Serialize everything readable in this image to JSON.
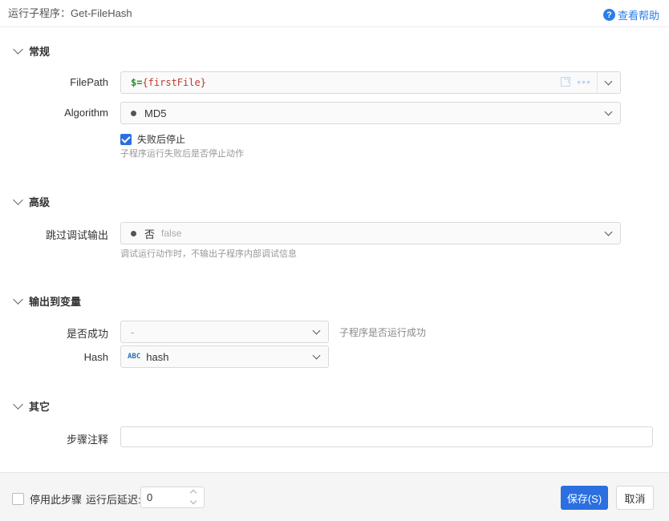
{
  "header": {
    "title": "运行子程序：Get-FileHash",
    "help_label": "查看帮助"
  },
  "sections": {
    "general": {
      "title": "常规",
      "filepath": {
        "label": "FilePath",
        "expr_dollar": "$=",
        "expr_var": "{firstFile}"
      },
      "algorithm": {
        "label": "Algorithm",
        "value": "MD5"
      },
      "stop_on_fail": {
        "label": "失败后停止",
        "checked": true,
        "hint": "子程序运行失败后是否停止动作"
      }
    },
    "advanced": {
      "title": "高级",
      "skip_debug": {
        "label": "跳过调试输出",
        "value": "否",
        "value_sub": "false",
        "hint": "调试运行动作时，不输出子程序内部调试信息"
      }
    },
    "output": {
      "title": "输出到变量",
      "success": {
        "label": "是否成功",
        "value": "-",
        "hint": "子程序是否运行成功"
      },
      "hash": {
        "label": "Hash",
        "type_badge": "ABC",
        "value": "hash"
      }
    },
    "other": {
      "title": "其它",
      "note": {
        "label": "步骤注释",
        "value": ""
      }
    }
  },
  "footer": {
    "disable_label": "停用此步骤",
    "disable_checked": false,
    "delay_label": "运行后延迟:",
    "delay_value": "0",
    "save_label": "保存(S)",
    "cancel_label": "取消"
  },
  "colors": {
    "accent": "#2b6fe0",
    "link": "#2b7de9"
  }
}
